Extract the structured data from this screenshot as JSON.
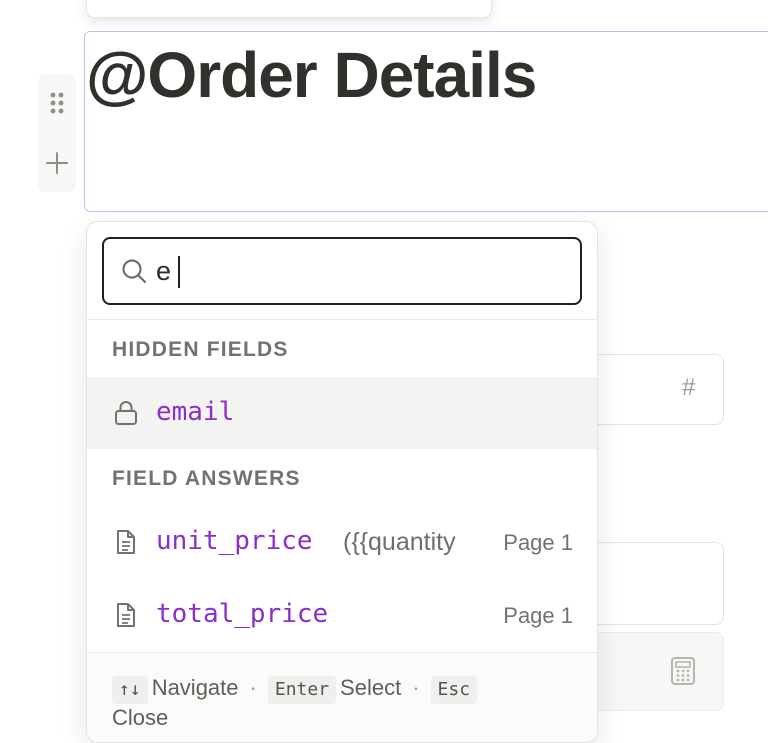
{
  "editor": {
    "title": "@Order Details"
  },
  "background_fields": {
    "number_symbol": "#"
  },
  "mention_menu": {
    "search": {
      "value": "e",
      "placeholder": ""
    },
    "sections": [
      {
        "label": "HIDDEN FIELDS",
        "items": [
          {
            "icon": "lock-icon",
            "name": "email",
            "subtitle": "",
            "page": ""
          }
        ]
      },
      {
        "label": "FIELD ANSWERS",
        "items": [
          {
            "icon": "document-icon",
            "name": "unit_price",
            "subtitle": "({{quantity",
            "page": "Page 1"
          },
          {
            "icon": "document-icon",
            "name": "total_price",
            "subtitle": "",
            "page": "Page 1"
          }
        ]
      }
    ],
    "footer": {
      "navigate_key": "↑↓",
      "navigate_label": "Navigate",
      "select_key": "Enter",
      "select_label": "Select",
      "close_key": "Esc",
      "close_label": "Close",
      "separator": "·"
    }
  },
  "colors": {
    "field_name": "#8b2fc9",
    "focus_border": "#b8c7ec",
    "selected_row": "#f3f3f2"
  }
}
